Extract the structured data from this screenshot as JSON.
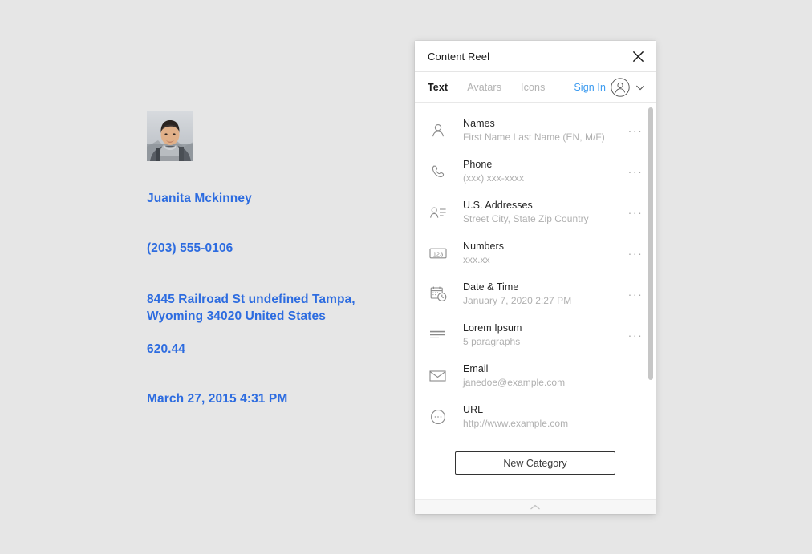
{
  "canvas": {
    "avatar_alt": "person-photo",
    "texts": {
      "name": "Juanita Mckinney",
      "phone": "(203) 555-0106",
      "address": "8445 Railroad St undefined Tampa,\nWyoming 34020 United States",
      "number": "620.44",
      "datetime": "March 27, 2015 4:31 PM"
    },
    "text_color": "#2d6ce0"
  },
  "panel": {
    "title": "Content Reel",
    "close_label": "close-icon",
    "tabs": [
      {
        "label": "Text",
        "active": true
      },
      {
        "label": "Avatars",
        "active": false
      },
      {
        "label": "Icons",
        "active": false
      }
    ],
    "account": {
      "sign_in_label": "Sign In",
      "sign_in_color": "#3c9bf0",
      "avatar_icon": "user-circle-icon",
      "chevron_icon": "chevron-down-icon"
    },
    "list": [
      {
        "icon": "person-icon",
        "title": "Names",
        "subtitle": "First Name Last Name (EN, M/F)",
        "menu": "···",
        "has_menu": true
      },
      {
        "icon": "phone-icon",
        "title": "Phone",
        "subtitle": "(xxx) xxx-xxxx",
        "menu": "···",
        "has_menu": true
      },
      {
        "icon": "contact-icon",
        "title": "U.S. Addresses",
        "subtitle": "Street City, State Zip Country",
        "menu": "···",
        "has_menu": true
      },
      {
        "icon": "numbers-icon",
        "title": "Numbers",
        "subtitle": "xxx.xx",
        "menu": "···",
        "has_menu": true
      },
      {
        "icon": "calendar-clock-icon",
        "title": "Date & Time",
        "subtitle": "January 7, 2020 2:27 PM",
        "menu": "···",
        "has_menu": true
      },
      {
        "icon": "paragraph-icon",
        "title": "Lorem Ipsum",
        "subtitle": "5 paragraphs",
        "menu": "···",
        "has_menu": true
      },
      {
        "icon": "envelope-icon",
        "title": "Email",
        "subtitle": "janedoe@example.com",
        "menu": "",
        "has_menu": false
      },
      {
        "icon": "url-circle-icon",
        "title": "URL",
        "subtitle": "http://www.example.com",
        "menu": "",
        "has_menu": false
      }
    ],
    "new_category_label": "New Category",
    "footer_icon": "chevron-up-icon"
  },
  "colors": {
    "background": "#e6e6e6",
    "panel_bg": "#ffffff",
    "accent_blue": "#2d6ce0",
    "link_blue": "#3c9bf0",
    "muted_text": "#b0b0b0",
    "footer_bg": "#f7f7f7"
  }
}
